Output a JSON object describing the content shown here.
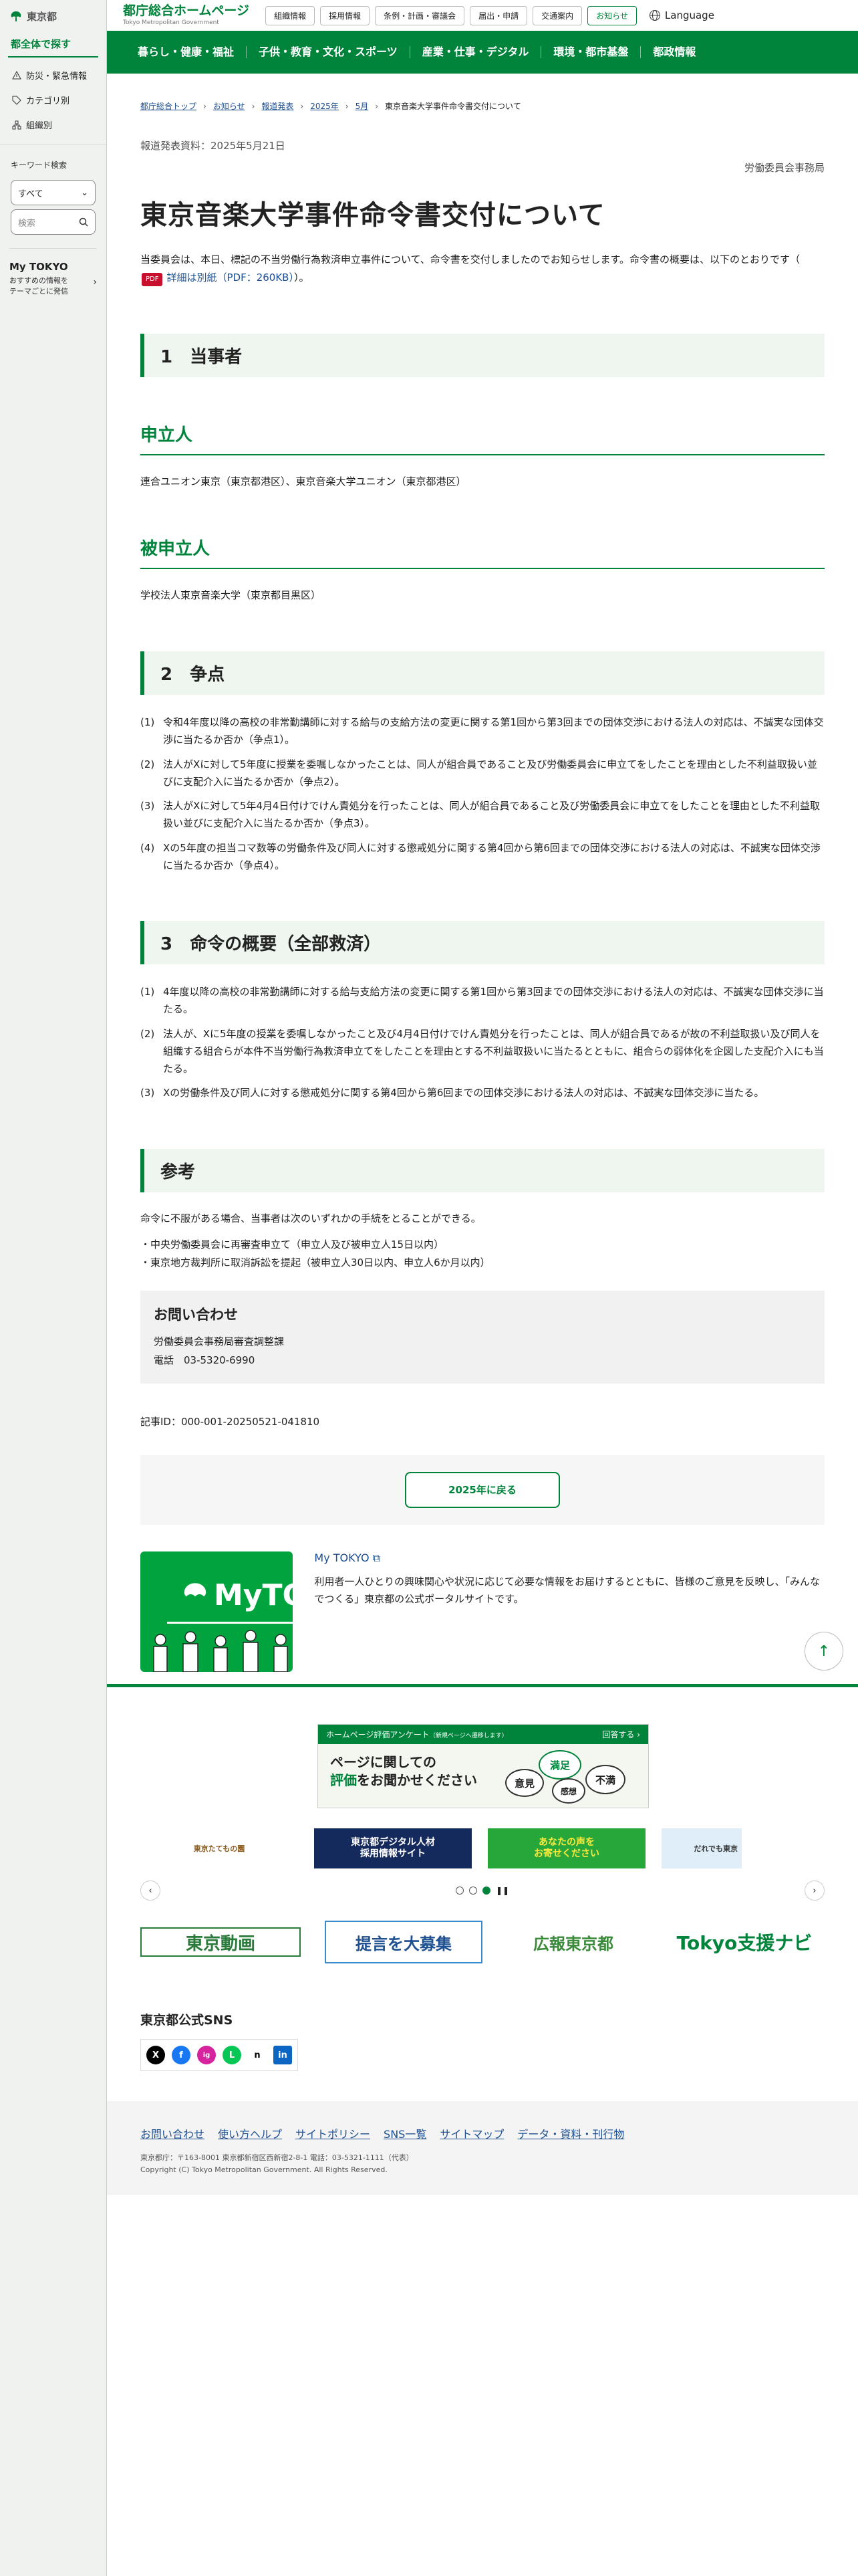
{
  "sidebar": {
    "logo": "東京都",
    "find_all": "都全体で探す",
    "items": [
      {
        "label": "防災・緊急情報"
      },
      {
        "label": "カテゴリ別"
      },
      {
        "label": "組織別"
      }
    ],
    "keyword_label": "キーワード検索",
    "select_value": "すべて",
    "search_placeholder": "検索",
    "mytokyo_title": "My TOKYO",
    "mytokyo_sub": "おすすめの情報を\nテーマごとに発信"
  },
  "header": {
    "title": "都庁総合ホームページ",
    "subtitle": "Tokyo Metropolitan Government",
    "nav": [
      "組織情報",
      "採用情報",
      "条例・計画・審議会",
      "届出・申請",
      "交通案内",
      "お知らせ"
    ],
    "language": "Language"
  },
  "gnav": [
    "暮らし・健康・福祉",
    "子供・教育・文化・スポーツ",
    "産業・仕事・デジタル",
    "環境・都市基盤",
    "都政情報"
  ],
  "breadcrumb": [
    "都庁総合トップ",
    "お知らせ",
    "報道発表",
    "2025年",
    "5月",
    "東京音楽大学事件命令書交付について"
  ],
  "release_date": "報道発表資料：2025年5月21日",
  "department": "労働委員会事務局",
  "title": "東京音楽大学事件命令書交付について",
  "lead_text": "当委員会は、本日、標記の不当労働行為救済申立事件について、命令書を交付しましたのでお知らせします。命令書の概要は、以下のとおりです（",
  "pdf_badge": "PDF",
  "lead_link": "詳細は別紙（PDF：260KB）",
  "lead_end": "）。",
  "section1": {
    "title": "1　当事者",
    "applicant_heading": "申立人",
    "applicant": "連合ユニオン東京（東京都港区）、東京音楽大学ユニオン（東京都港区）",
    "respondent_heading": "被申立人",
    "respondent": "学校法人東京音楽大学（東京都目黒区）"
  },
  "section2": {
    "title": "2　争点",
    "items": [
      {
        "n": "(1)",
        "text": "令和4年度以降の高校の非常勤講師に対する給与の支給方法の変更に関する第1回から第3回までの団体交渉における法人の対応は、不誠実な団体交渉に当たるか否か（争点1）。"
      },
      {
        "n": "(2)",
        "text": "法人がXに対して5年度に授業を委嘱しなかったことは、同人が組合員であること及び労働委員会に申立てをしたことを理由とした不利益取扱い並びに支配介入に当たるか否か（争点2）。"
      },
      {
        "n": "(3)",
        "text": "法人がXに対して5年4月4日付けでけん責処分を行ったことは、同人が組合員であること及び労働委員会に申立てをしたことを理由とした不利益取扱い並びに支配介入に当たるか否か（争点3）。"
      },
      {
        "n": "(4)",
        "text": "Xの5年度の担当コマ数等の労働条件及び同人に対する懲戒処分に関する第4回から第6回までの団体交渉における法人の対応は、不誠実な団体交渉に当たるか否か（争点4）。"
      }
    ]
  },
  "section3": {
    "title": "3　命令の概要（全部救済）",
    "items": [
      {
        "n": "(1)",
        "text": "4年度以降の高校の非常勤講師に対する給与支給方法の変更に関する第1回から第3回までの団体交渉における法人の対応は、不誠実な団体交渉に当たる。"
      },
      {
        "n": "(2)",
        "text": "法人が、Xに5年度の授業を委嘱しなかったこと及び4月4日付けでけん責処分を行ったことは、同人が組合員であるが故の不利益取扱い及び同人を組織する組合らが本件不当労働行為救済申立てをしたことを理由とする不利益取扱いに当たるとともに、組合らの弱体化を企図した支配介入にも当たる。"
      },
      {
        "n": "(3)",
        "text": "Xの労働条件及び同人に対する懲戒処分に関する第4回から第6回までの団体交渉における法人の対応は、不誠実な団体交渉に当たる。"
      }
    ]
  },
  "reference": {
    "title": "参考",
    "intro": "命令に不服がある場合、当事者は次のいずれかの手続をとることができる。",
    "items": [
      "中央労働委員会に再審査申立て（申立人及び被申立人15日以内）",
      "東京地方裁判所に取消訴訟を提起（被申立人30日以内、申立人6か月以内）"
    ]
  },
  "contact": {
    "title": "お問い合わせ",
    "dept": "労働委員会事務局審査調整課",
    "tel": "電話　03-5320-6990"
  },
  "article_id": "記事ID：000-001-20250521-041810",
  "back_button": "2025年に戻る",
  "mytokyo": {
    "link": "My TOKYO",
    "brand": "MyTOKYO",
    "desc": "利用者一人ひとりの興味関心や状況に応じて必要な情報をお届けするとともに、皆様のご意見を反映し、「みんなでつくる」東京都の公式ポータルサイトです。"
  },
  "survey": {
    "header": "ホームページ評価アンケート",
    "header_note": "（新規ページへ遷移します）",
    "answer": "回答する",
    "line1": "ページに関しての",
    "line2_em": "評価",
    "line2_rest": "をお聞かせください",
    "words": [
      "満足",
      "不満",
      "意見",
      "感想"
    ]
  },
  "banners": [
    "東京たてもの園",
    "東京都デジタル人材\n採用情報サイト",
    "あなたの声を\nお寄せください",
    "だれでも東京"
  ],
  "banners2": [
    "東京動画",
    "提言を大募集",
    "広報東京都",
    "Tokyo支援ナビ"
  ],
  "sns": {
    "title": "東京都公式SNS",
    "icons": [
      "X",
      "f",
      "ig",
      "L",
      "n",
      "in"
    ]
  },
  "footer": {
    "links": [
      "お問い合わせ",
      "使い方ヘルプ",
      "サイトポリシー",
      "SNS一覧",
      "サイトマップ",
      "データ・資料・刊行物"
    ],
    "address": "東京都庁：〒163-8001 東京都新宿区西新宿2-8-1 電話：03-5321-1111（代表）",
    "copyright": "Copyright (C) Tokyo Metropolitan Government. All Rights Reserved."
  },
  "colors": {
    "brand": "#00833b",
    "link": "#1d4f91",
    "pdf": "#c8102e"
  }
}
